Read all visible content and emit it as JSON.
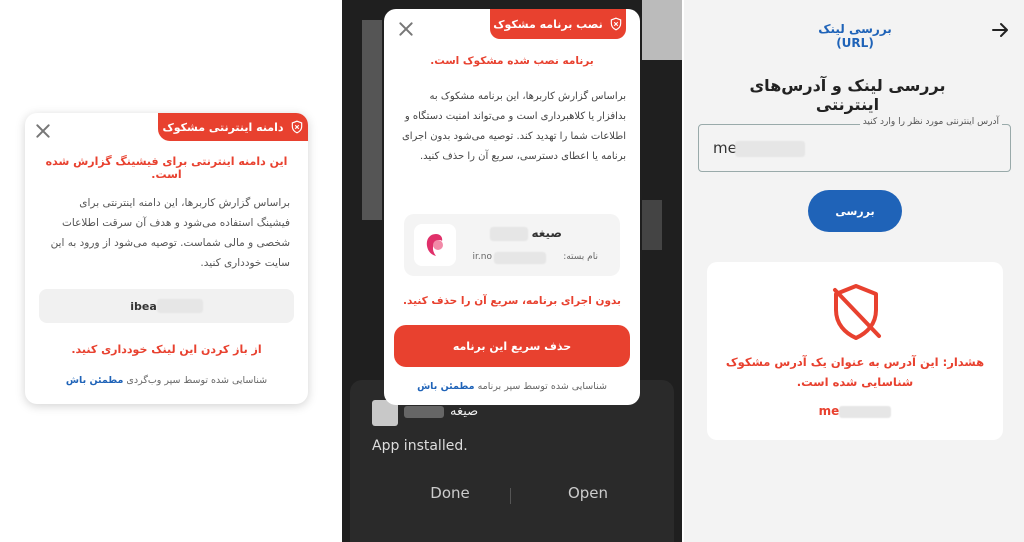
{
  "panel1": {
    "badge": "دامنه اینترنتی مشکوک",
    "title": "این دامنه اینترنتی برای فیشینگ گزارش شده است.",
    "body": "براساس گزارش کاربرها، این دامنه اینترنتی برای فیشینگ استفاده می‌شود و هدف آن سرقت اطلاعات شخصی و مالی شماست. توصیه می‌شود از ورود به این سایت خودداری کنید.",
    "url_prefix": "ibea",
    "warning": "از باز کردن این لینک خودداری کنید.",
    "footer_text": "شناسایی شده توسط سپر وب‌گردی",
    "footer_brand": "مطمئن باش"
  },
  "panel2": {
    "badge": "نصب برنامه مشکوک",
    "title": "برنامه نصب شده مشکوک است.",
    "body": "براساس گزارش کاربرها، این برنامه مشکوک به بدافزار یا کلاهبرداری است و می‌تواند امنیت دستگاه و اطلاعات شما را تهدید کند. توصیه می‌شود بدون اجرای برنامه یا اعطای دسترسی، سریع آن را حذف کنید.",
    "app_name": "صیغه",
    "package_label": "نام بسته:",
    "package_prefix": "ir.no",
    "warning": "بدون اجرای برنامه، سریع آن را حذف کنید.",
    "button": "حذف سریع این برنامه",
    "footer_text": "شناسایی شده توسط سپر برنامه",
    "footer_brand": "مطمئن باش",
    "notification": {
      "app_name": "صیغه",
      "message": "App installed.",
      "done": "Done",
      "open": "Open"
    }
  },
  "panel3": {
    "header": "بررسی لینک (URL)",
    "title": "بررسی لینک و آدرس‌های اینترنتی",
    "field_label": "آدرس اینترنتی مورد نظر را وارد کنید",
    "field_value": "me",
    "button": "بررسی",
    "warning": "هشدار: این آدرس به عنوان یک آدرس مشکوک شناسایی شده است.",
    "url_prefix": "me"
  },
  "colors": {
    "alert_red": "#e8412f",
    "brand_blue": "#1f63b8"
  }
}
